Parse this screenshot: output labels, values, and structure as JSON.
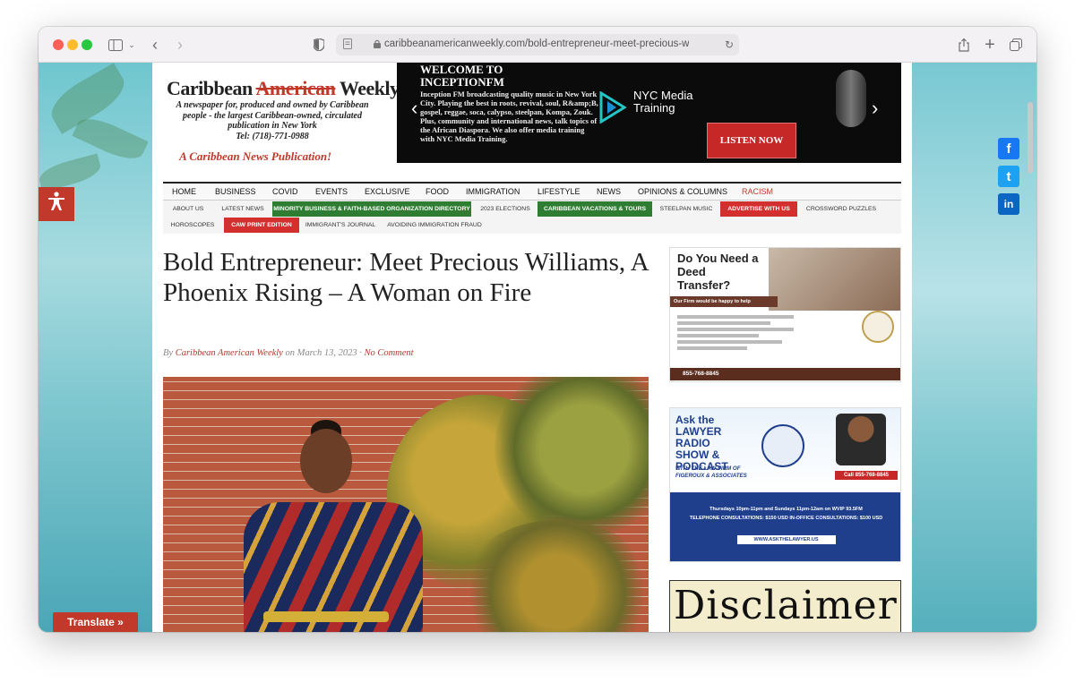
{
  "browser": {
    "url": "caribbeanamericanweekly.com/bold-entrepreneur-meet-precious-williams-a-p"
  },
  "header": {
    "logo_title_prefix": "Caribbean ",
    "logo_title_mid": "American",
    "logo_title_suffix": " Weekly",
    "logo_subtitle": "A newspaper for, produced and owned by Caribbean people - the largest Caribbean-owned, circulated publication in New York",
    "logo_phone": "Tel: (718)-771-0988",
    "logo_tagline": "A Caribbean News Publication!"
  },
  "banner": {
    "heading": "WELCOME TO INCEPTIONFM",
    "body": "Inception FM broadcasting quality music in New York City. Playing the best in roots, revival, soul, R&amp;B, gospel, reggae, soca, calypso, steelpan, Kompa, Zouk. Plus, community and international news, talk topics of the African Diaspora. We also offer media training with NYC Media Training.",
    "brand": "NYC Media Training",
    "cta": "LISTEN NOW"
  },
  "nav": {
    "items": [
      "HOME",
      "BUSINESS",
      "COVID",
      "EVENTS",
      "EXCLUSIVE",
      "FOOD",
      "IMMIGRATION",
      "LIFESTYLE",
      "NEWS",
      "OPINIONS & COLUMNS",
      "RACISM"
    ]
  },
  "subnav": {
    "row1": [
      "ABOUT US",
      "LATEST NEWS",
      "MINORITY BUSINESS & FAITH-BASED ORGANIZATION DIRECTORY",
      "2023 ELECTIONS",
      "CARIBBEAN VACATIONS & TOURS",
      "STEELPAN MUSIC",
      "ADVERTISE WITH US",
      "CROSSWORD PUZZLES"
    ],
    "row2": [
      "HOROSCOPES",
      "CAW PRINT EDITION",
      "IMMIGRANT'S JOURNAL",
      "AVOIDING IMMIGRATION FRAUD"
    ]
  },
  "article": {
    "title": "Bold Entrepreneur: Meet Precious Williams, A Phoenix Rising – A Woman on Fire",
    "by_prefix": "By ",
    "author": "Caribbean American Weekly",
    "date_text": " on March 13, 2023 · ",
    "comments": "No Comment"
  },
  "sidebar": {
    "ad1": {
      "heading": "Do You Need a Deed Transfer?",
      "strip": "Our Firm would be happy to help",
      "phone": "855-768-8845"
    },
    "ad2": {
      "heading": "Ask the LAWYER RADIO SHOW & PODCAST",
      "sub": "WITH THE LAW FIRM OF FIGEROUX & ASSOCIATES",
      "cta": "Call 855-768-8845",
      "schedule": "Thursdays 10pm-11pm and Sundays 11pm-12am on WVIP 93.5FM",
      "consult": "TELEPHONE CONSULTATIONS: $150 USD   IN-OFFICE CONSULTATIONS: $100 USD",
      "site": "WWW.ASKTHELAWYER.US"
    },
    "ad3": {
      "text": "Disclaimer"
    }
  },
  "widgets": {
    "translate": "Translate »",
    "facebook": "f",
    "twitter": "t",
    "linkedin": "in"
  },
  "colors": {
    "brand_red": "#c0392b",
    "nav_green": "#2e7d32",
    "nav_red": "#d32f2f"
  }
}
